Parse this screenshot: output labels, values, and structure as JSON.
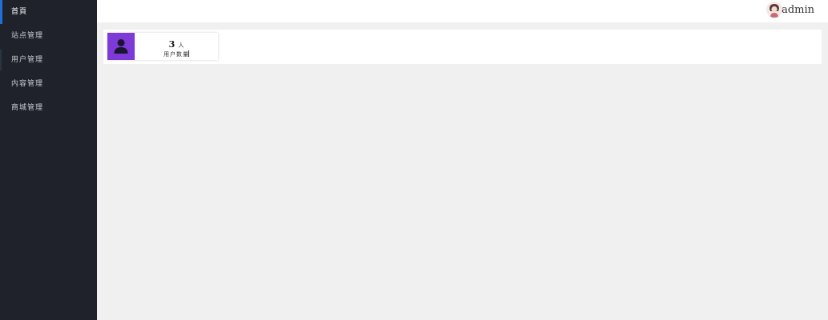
{
  "sidebar": {
    "items": [
      {
        "label": "首頁"
      },
      {
        "label": "站点管理"
      },
      {
        "label": "用户管理"
      },
      {
        "label": "内容管理"
      },
      {
        "label": "商城管理"
      }
    ]
  },
  "header": {
    "avatar_icon": "avatar-icon",
    "username": "admin"
  },
  "dashboard": {
    "stat": {
      "icon": "user-icon",
      "icon_color": "#7d3ad8",
      "value": "3",
      "unit": "人",
      "label": "用户数量"
    }
  },
  "colors": {
    "sidebar_bg": "#1f222b",
    "accent": "#1e6fd9",
    "content_bg": "#f0f0f0"
  }
}
